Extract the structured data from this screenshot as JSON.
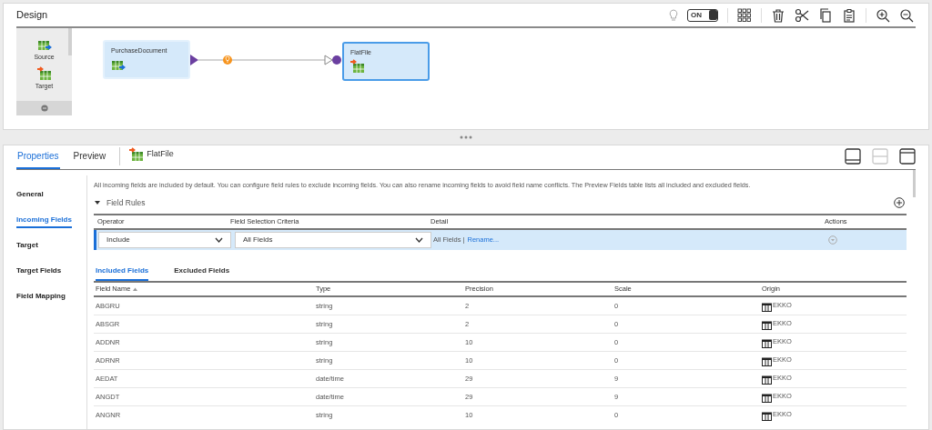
{
  "design": {
    "title": "Design",
    "hint_on": false,
    "toggle": {
      "label": "ON",
      "on": true
    },
    "palette": [
      {
        "label": "Source",
        "kind": "source"
      },
      {
        "label": "Target",
        "kind": "target"
      }
    ],
    "nodes": [
      {
        "label": "PurchaseDocument",
        "kind": "source",
        "selected": false
      },
      {
        "label": "FlatFile",
        "kind": "target",
        "selected": true
      }
    ]
  },
  "properties": {
    "tabs": [
      {
        "label": "Properties",
        "selected": true
      },
      {
        "label": "Preview",
        "selected": false
      }
    ],
    "object": {
      "label": "FlatFile",
      "kind": "target"
    },
    "layout_buttons": [
      {
        "kind": "bottom",
        "disabled": false
      },
      {
        "kind": "split",
        "disabled": true
      },
      {
        "kind": "top",
        "disabled": false
      }
    ],
    "nav": [
      {
        "label": "General",
        "selected": false
      },
      {
        "label": "Incoming Fields",
        "selected": true
      },
      {
        "label": "Target",
        "selected": false
      },
      {
        "label": "Target Fields",
        "selected": false
      },
      {
        "label": "Field Mapping",
        "selected": false
      }
    ],
    "description": "All incoming fields are included by default. You can configure field rules to exclude incoming fields. You can also rename incoming fields to avoid field name conflicts. The Preview Fields table lists all included and excluded fields.",
    "field_rules": {
      "title": "Field Rules",
      "expanded": true,
      "columns": [
        "Operator",
        "Field Selection Criteria",
        "Detail",
        "Actions"
      ],
      "rows": [
        {
          "operator": "Include",
          "criteria": "All Fields",
          "detail": "All Fields |",
          "link": "Rename...",
          "selected": true
        }
      ]
    },
    "field_tabs": [
      {
        "label": "Included Fields",
        "selected": true
      },
      {
        "label": "Excluded Fields",
        "selected": false
      }
    ],
    "table": {
      "columns": [
        "Field Name",
        "Type",
        "Precision",
        "Scale",
        "Origin"
      ],
      "rows": [
        [
          "ABGRU",
          "string",
          "2",
          "0",
          "EKKO"
        ],
        [
          "ABSGR",
          "string",
          "2",
          "0",
          "EKKO"
        ],
        [
          "ADDNR",
          "string",
          "10",
          "0",
          "EKKO"
        ],
        [
          "ADRNR",
          "string",
          "10",
          "0",
          "EKKO"
        ],
        [
          "AEDAT",
          "date/time",
          "29",
          "9",
          "EKKO"
        ],
        [
          "ANGDT",
          "date/time",
          "29",
          "9",
          "EKKO"
        ],
        [
          "ANGNR",
          "string",
          "10",
          "0",
          "EKKO"
        ]
      ]
    }
  }
}
